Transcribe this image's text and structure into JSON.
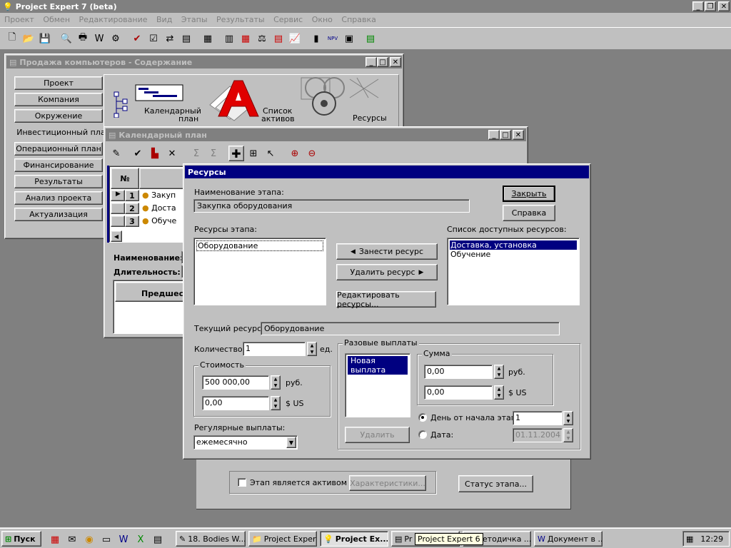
{
  "app": {
    "title": "Project Expert 7 (beta)",
    "menu": [
      "Проект",
      "Обмен",
      "Редактирование",
      "Вид",
      "Этапы",
      "Результаты",
      "Сервис",
      "Окно",
      "Справка"
    ]
  },
  "content_window": {
    "title": "Продажа компьютеров - Содержание",
    "nav": [
      "Проект",
      "Компания",
      "Окружение",
      "Инвестиционный план",
      "Операционный план",
      "Финансирование",
      "Результаты",
      "Анализ проекта",
      "Актуализация"
    ],
    "selected_nav": "Инвестиционный план",
    "modules": [
      {
        "label_line1": "Календарный",
        "label_line2": "план",
        "icon": "gantt-icon"
      },
      {
        "label_line1": "Список",
        "label_line2": "активов",
        "icon": "assets-icon"
      },
      {
        "label_line1": "Ресурсы",
        "label_line2": "",
        "icon": "resources-icon"
      }
    ]
  },
  "calendar_window": {
    "title": "Календарный план",
    "table": {
      "header_num": "№",
      "rows": [
        {
          "num": "1",
          "name": "Закуп"
        },
        {
          "num": "2",
          "name": "Доста"
        },
        {
          "num": "3",
          "name": "Обуче"
        }
      ]
    },
    "name_label": "Наименование:",
    "duration_label": "Длительность:",
    "predecessors_header": "Предшест",
    "active_checkbox_label": "Этап является активом",
    "characteristics_button": "Характеристики...",
    "status_button": "Статус этапа..."
  },
  "dialog": {
    "title": "Ресурсы",
    "stage_name_label": "Наименование этапа:",
    "stage_name_value": "Закупка оборудования",
    "close_button": "Закрыть",
    "help_button": "Справка",
    "stage_resources_label": "Ресурсы этапа:",
    "stage_resources": [
      "Оборудование"
    ],
    "available_resources_label": "Список доступных ресурсов:",
    "available_resources": [
      "Доставка, установка",
      "Обучение"
    ],
    "add_resource_button": "Занести ресурс",
    "remove_resource_button": "Удалить ресурс",
    "edit_resources_button": "Редактировать ресурсы...",
    "current_resource_label": "Текущий ресурс:",
    "current_resource_value": "Оборудование",
    "quantity_label": "Количество:",
    "quantity_value": "1",
    "quantity_unit": "ед.",
    "cost_group": "Стоимость",
    "cost_rub_value": "500 000,00",
    "cost_rub_unit": "руб.",
    "cost_usd_value": "0,00",
    "cost_usd_unit": "$ US",
    "regular_payments_label": "Регулярные выплаты:",
    "regular_payments_value": "ежемесячно",
    "one_time_group": "Разовые выплаты",
    "one_time_items": [
      "Новая выплата"
    ],
    "delete_button": "Удалить",
    "sum_group": "Сумма",
    "sum_rub_value": "0,00",
    "sum_rub_unit": "руб.",
    "sum_usd_value": "0,00",
    "sum_usd_unit": "$ US",
    "day_from_start_label": "День от начала этапа:",
    "day_from_start_value": "1",
    "date_label": "Дата:",
    "date_value": "01.11.2004"
  },
  "taskbar": {
    "start": "Пуск",
    "tasks": [
      "18. Bodies W...",
      "Project Expert",
      "Project Ex...",
      "Pr",
      "Методичка ...",
      "Документ в ..."
    ],
    "tooltip": "Project Expert 6",
    "clock": "12:29"
  }
}
